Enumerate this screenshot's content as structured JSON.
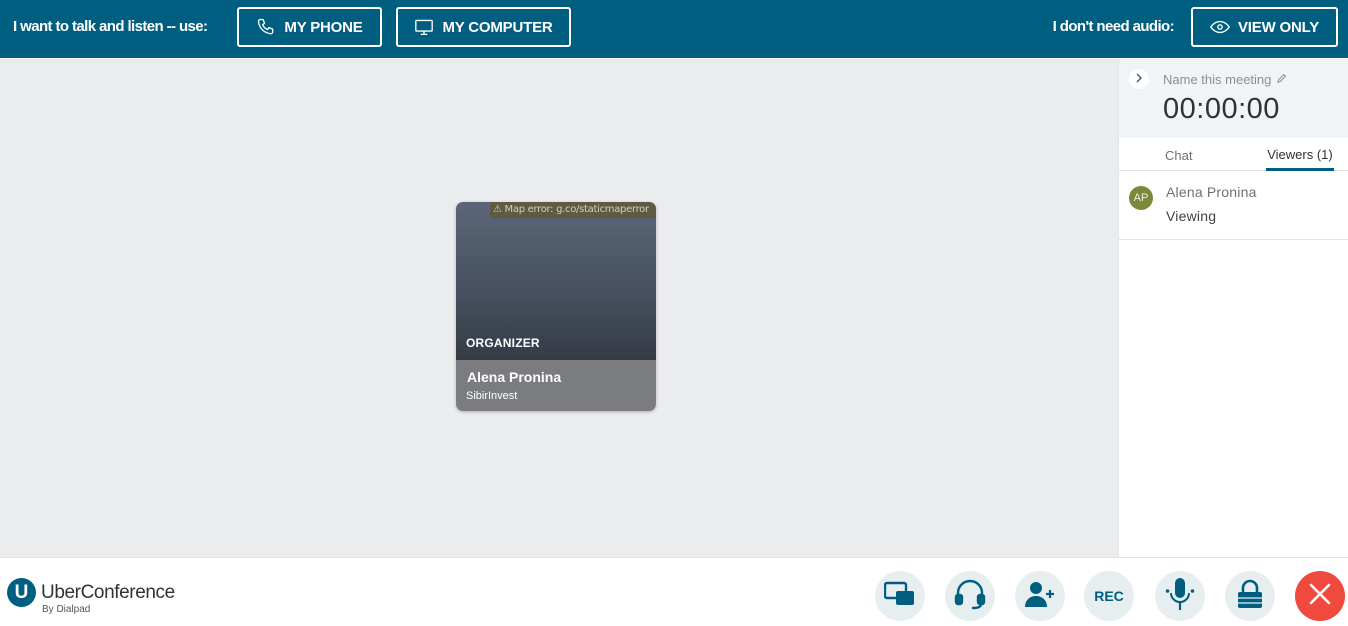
{
  "audio_bar": {
    "prompt": "I want to talk and listen -- use:",
    "phone_button": "MY PHONE",
    "computer_button": "MY COMPUTER",
    "no_audio_prompt": "I don't need audio:",
    "view_only_button": "VIEW ONLY"
  },
  "participant_card": {
    "map_error": "⚠ Map error: g.co/staticmaperror",
    "role": "ORGANIZER",
    "name": "Alena Pronina",
    "company": "SibirInvest"
  },
  "sidebar": {
    "meeting_name_placeholder": "Name this meeting",
    "timer": "00:00:00",
    "tabs": [
      {
        "label": "Chat",
        "active": false
      },
      {
        "label": "Viewers (1)",
        "active": true
      }
    ],
    "viewers": [
      {
        "initials": "AP",
        "name": "Alena Pronina",
        "status": "Viewing",
        "avatar_color": "#7a8a3a"
      }
    ]
  },
  "bottom_bar": {
    "logo_glyph": "U",
    "brand": "UberConference",
    "brand_sub": "By Dialpad",
    "controls": [
      {
        "name": "screen-share",
        "icon": "screen-share-icon"
      },
      {
        "name": "audio",
        "icon": "headset-icon"
      },
      {
        "name": "invite",
        "icon": "add-user-icon"
      },
      {
        "name": "record",
        "label": "REC"
      },
      {
        "name": "microphone",
        "icon": "microphone-icon"
      },
      {
        "name": "lock",
        "icon": "lock-icon"
      },
      {
        "name": "hang-up",
        "icon": "close-icon"
      }
    ]
  },
  "colors": {
    "brand": "#005f80",
    "stage_bg": "#ebecee",
    "hangup": "#f04a3e"
  }
}
